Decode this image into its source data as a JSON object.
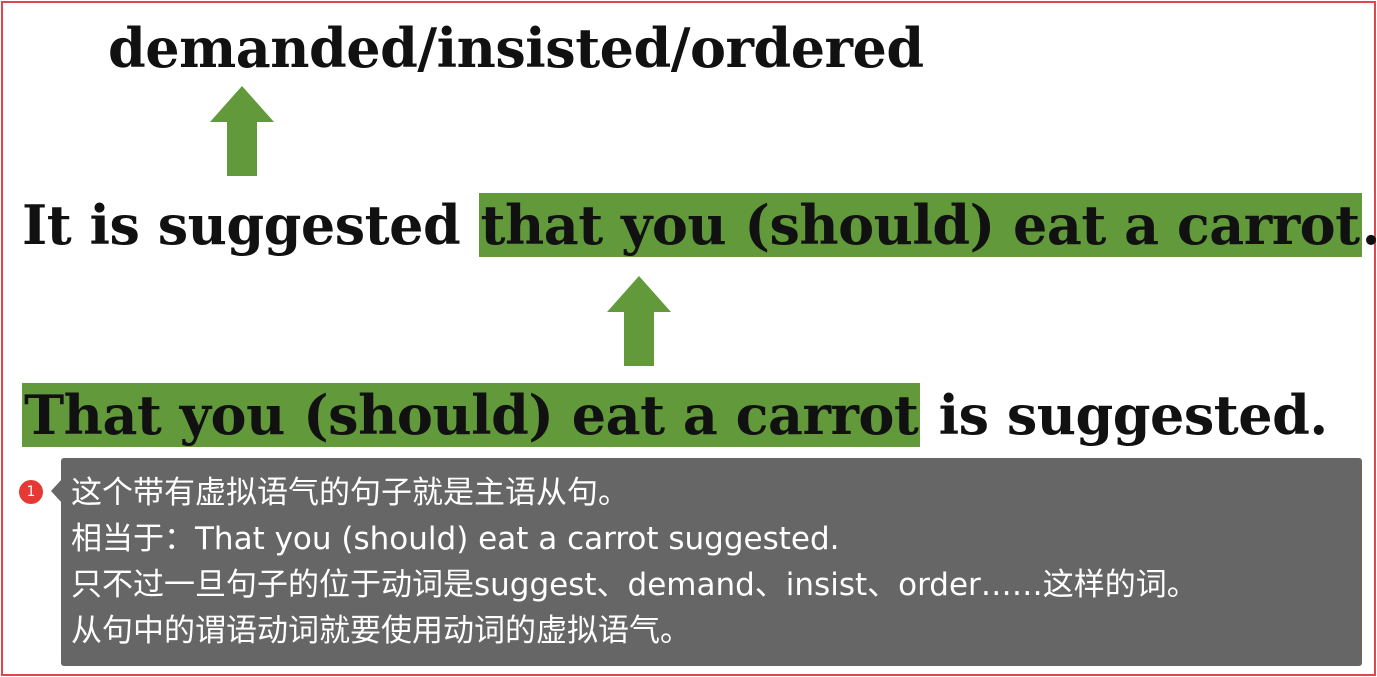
{
  "slide": {
    "line1": "demanded/insisted/ordered",
    "line2": {
      "prefix": "It is suggested ",
      "highlight": "that you (should) eat a carrot",
      "suffix": "."
    },
    "line3": {
      "highlight": "That you (should) eat a carrot",
      "suffix": " is suggested."
    },
    "highlight_color": "#62993a",
    "arrow_color": "#62993a"
  },
  "annotation": {
    "badge": "1",
    "badge_color": "#e53935",
    "lines": [
      "这个带有虚拟语气的句子就是主语从句。",
      "相当于：That you (should) eat a carrot suggested.",
      "只不过一旦句子的位于动词是suggest、demand、insist、order……这样的词。",
      "从句中的谓语动词就要使用动词的虚拟语气。"
    ]
  }
}
